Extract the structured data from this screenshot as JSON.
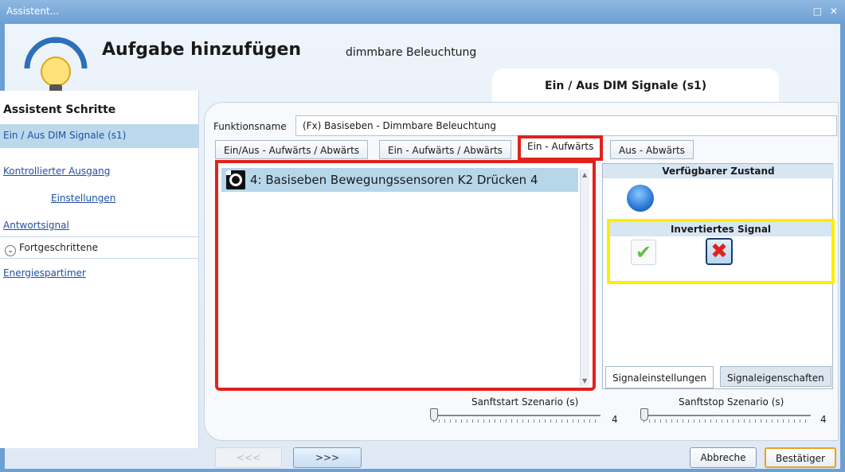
{
  "window": {
    "title": "Assistent..."
  },
  "header": {
    "title": "Aufgabe hinzufügen",
    "subtitle": "dimmbare Beleuchtung",
    "step_title": "Ein / Aus DIM Signale (s1)"
  },
  "sidebar": {
    "title": "Assistent Schritte",
    "items": [
      {
        "label": "Ein / Aus DIM Signale (s1)"
      },
      {
        "label": "Kontrollierter Ausgang"
      },
      {
        "label": "Einstellungen"
      },
      {
        "label": "Antwortsignal"
      },
      {
        "label": "Fortgeschrittene"
      },
      {
        "label": "Energiespartimer"
      }
    ]
  },
  "function": {
    "label": "Funktionsname",
    "value": "(Fx) Basiseben - Dimmbare Beleuchtung"
  },
  "tabs": [
    {
      "label": "Ein/Aus - Aufwärts / Abwärts"
    },
    {
      "label": "Ein - Aufwärts / Abwärts"
    },
    {
      "label": "Ein - Aufwärts",
      "active": true
    },
    {
      "label": "Aus - Abwärts"
    }
  ],
  "list": {
    "items": [
      {
        "label": "4: Basiseben Bewegungssensoren K2 Drücken 4"
      }
    ]
  },
  "right_panel": {
    "available_state": "Verfügbarer Zustand",
    "inverted_signal": "Invertiertes Signal",
    "subtabs": [
      {
        "label": "Signaleinstellungen"
      },
      {
        "label": "Signaleigenschaften"
      }
    ]
  },
  "sliders": {
    "softstart": {
      "label": "Sanftstart Szenario (s)",
      "value": "4"
    },
    "softstop": {
      "label": "Sanftstop Szenario (s)",
      "value": "4"
    }
  },
  "nav": {
    "prev": "<<<",
    "next": ">>>"
  },
  "actions": {
    "abort": "Abbreche",
    "confirm": "Bestätiger"
  },
  "colors": {
    "highlight_red": "#e0221c",
    "highlight_yellow": "#ffed00",
    "accent": "#6d9fd3"
  }
}
